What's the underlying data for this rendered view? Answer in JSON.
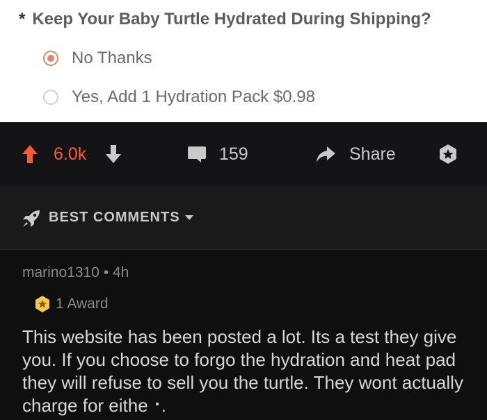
{
  "form": {
    "required_mark": "*",
    "question": "Keep Your Baby Turtle Hydrated During Shipping?",
    "options": [
      {
        "label": "No Thanks",
        "selected": true
      },
      {
        "label": "Yes, Add 1 Hydration Pack $0.98",
        "selected": false
      }
    ]
  },
  "post_actions": {
    "vote_count": "6.0k",
    "comment_count": "159",
    "share_label": "Share"
  },
  "sort": {
    "label": "BEST COMMENTS"
  },
  "comment": {
    "username": "marino1310",
    "separator": "•",
    "age": "4h",
    "award_label": "1 Award",
    "body": "This website has been posted a lot. Its a test they give you. If you choose to forgo the hydration and heat pad they will refuse to sell you the turtle. They wont actually charge for eithe⠐."
  },
  "colors": {
    "upvote_accent": "#ff5a30",
    "radio_accent": "#e8836a",
    "dark_bg": "#0f0f10"
  }
}
